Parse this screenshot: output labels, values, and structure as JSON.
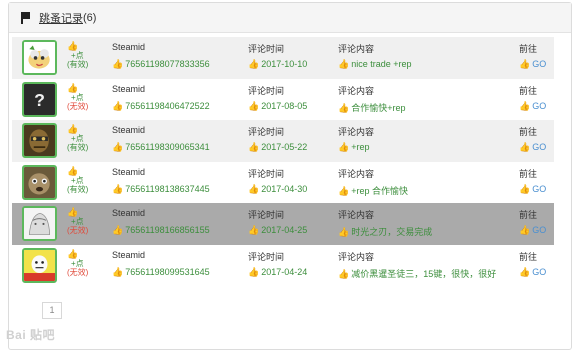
{
  "header": {
    "title": "跳蚤记录",
    "count": "(6)"
  },
  "columns": {
    "steamid": "Steamid",
    "time": "评论时间",
    "content": "评论内容",
    "go": "前往"
  },
  "rows": [
    {
      "plus": "+点",
      "status": "(有效)",
      "steamid": "76561198077833356",
      "time": "2017-10-10",
      "content": "nice trade +rep",
      "go": "GO"
    },
    {
      "plus": "+点",
      "status": "(无效)",
      "steamid": "76561198406472522",
      "time": "2017-08-05",
      "content": "合作愉快+rep",
      "go": "GO"
    },
    {
      "plus": "+点",
      "status": "(有效)",
      "steamid": "76561198309065341",
      "time": "2017-05-22",
      "content": "+rep",
      "go": "GO"
    },
    {
      "plus": "+点",
      "status": "(有效)",
      "steamid": "76561198138637445",
      "time": "2017-04-30",
      "content": "+rep 合作愉快",
      "go": "GO"
    },
    {
      "plus": "+点",
      "status": "(无效)",
      "steamid": "76561198166856155",
      "time": "2017-04-25",
      "content": "时光之刃，交易完成",
      "go": "GO"
    },
    {
      "plus": "+点",
      "status": "(无效)",
      "steamid": "76561198099531645",
      "time": "2017-04-24",
      "content": "减价黑暹圣徒三，15键，很快，很好",
      "go": "GO"
    }
  ],
  "pagination": {
    "current": "1"
  },
  "watermark": "Bai 贴吧"
}
